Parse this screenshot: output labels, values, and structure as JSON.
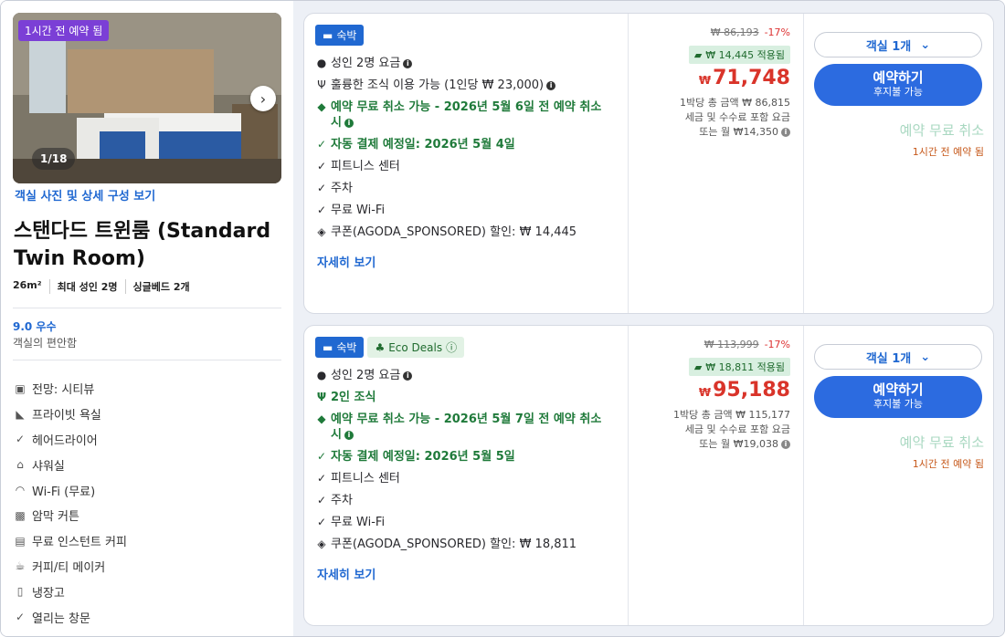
{
  "left": {
    "badge": "1시간 전 예약 됨",
    "photo_counter": "1/18",
    "photo_link": "객실 사진 및 상세 구성 보기",
    "room_title": "스탠다드 트윈룸 (Standard Twin Room)",
    "size": "26m²",
    "occupancy": "최대 성인 2명",
    "beds": "싱글베드 2개",
    "rating": "9.0 우수",
    "rating_sub": "객실의 편안함",
    "amenities": [
      {
        "icon": "view-icon",
        "label": "전망: 시티뷰"
      },
      {
        "icon": "bathtub-icon",
        "label": "프라이빗 욕실"
      },
      {
        "icon": "check-icon",
        "label": "헤어드라이어"
      },
      {
        "icon": "shower-icon",
        "label": "샤워실"
      },
      {
        "icon": "wifi-icon",
        "label": "Wi-Fi (무료)"
      },
      {
        "icon": "blackout-curtain-icon",
        "label": "암막 커튼"
      },
      {
        "icon": "coffee-machine-icon",
        "label": "무료 인스턴트 커피"
      },
      {
        "icon": "kettle-icon",
        "label": "커피/티 메이커"
      },
      {
        "icon": "fridge-icon",
        "label": "냉장고"
      },
      {
        "icon": "check-icon",
        "label": "열리는 창문"
      }
    ]
  },
  "offers": [
    {
      "tag_stay": "숙박",
      "tag_eco": "",
      "features": [
        {
          "text": "성인 2명 요금",
          "icon": "person-icon",
          "green": false,
          "info": true
        },
        {
          "text": "훌륭한 조식 이용 가능 (1인당 ₩ 23,000)",
          "icon": "cutlery-icon",
          "green": false,
          "info": true
        },
        {
          "text": "예약 무료 취소 가능 - 2026년 5월 6일 전 예약 취소 시",
          "icon": "shield-icon",
          "green": true,
          "info": true
        },
        {
          "text": "자동 결제 예정일: 2026년 5월 4일",
          "icon": "check-icon",
          "green": true,
          "info": false
        },
        {
          "text": "피트니스 센터",
          "icon": "check-icon",
          "green": false,
          "info": false
        },
        {
          "text": "주차",
          "icon": "check-icon",
          "green": false,
          "info": false
        },
        {
          "text": "무료 Wi-Fi",
          "icon": "check-icon",
          "green": false,
          "info": false
        },
        {
          "text": "쿠폰(AGODA_SPONSORED) 할인: ₩ 14,445",
          "icon": "tag-icon",
          "green": false,
          "info": false
        }
      ],
      "more": "자세히 보기",
      "original_price": "₩ 86,193",
      "discount": "-17%",
      "coupon_applied": "₩ 14,445 적용됨",
      "currency": "₩",
      "price": "71,748",
      "note1": "1박당 총 금액 ₩ 86,815",
      "note2": "세금 및 수수료 포함 요금",
      "note3": "또는 월 ₩14,350",
      "room_select": "객실 1개",
      "book_label": "예약하기",
      "book_sub": "후지불 가능",
      "free_cancel": "예약 무료 취소",
      "booked_ago": "1시간 전 예약 됨"
    },
    {
      "tag_stay": "숙박",
      "tag_eco": "Eco Deals",
      "features": [
        {
          "text": "성인 2명 요금",
          "icon": "person-icon",
          "green": false,
          "info": true
        },
        {
          "text": "2인 조식",
          "icon": "cutlery-icon",
          "green": true,
          "info": false
        },
        {
          "text": "예약 무료 취소 가능 - 2026년 5월 7일 전 예약 취소 시",
          "icon": "shield-icon",
          "green": true,
          "info": true
        },
        {
          "text": "자동 결제 예정일: 2026년 5월 5일",
          "icon": "check-icon",
          "green": true,
          "info": false
        },
        {
          "text": "피트니스 센터",
          "icon": "check-icon",
          "green": false,
          "info": false
        },
        {
          "text": "주차",
          "icon": "check-icon",
          "green": false,
          "info": false
        },
        {
          "text": "무료 Wi-Fi",
          "icon": "check-icon",
          "green": false,
          "info": false
        },
        {
          "text": "쿠폰(AGODA_SPONSORED) 할인: ₩ 18,811",
          "icon": "tag-icon",
          "green": false,
          "info": false
        }
      ],
      "more": "자세히 보기",
      "original_price": "₩ 113,999",
      "discount": "-17%",
      "coupon_applied": "₩ 18,811 적용됨",
      "currency": "₩",
      "price": "95,188",
      "note1": "1박당 총 금액 ₩ 115,177",
      "note2": "세금 및 수수료 포함 요금",
      "note3": "또는 월 ₩19,038",
      "room_select": "객실 1개",
      "book_label": "예약하기",
      "book_sub": "후지불 가능",
      "free_cancel": "예약 무료 취소",
      "booked_ago": "1시간 전 예약 됨"
    }
  ],
  "colors": {
    "primary": "#2c6be0",
    "price_red": "#d9342a",
    "green": "#1f7a3a",
    "badge_purple": "#7b3fd6"
  }
}
